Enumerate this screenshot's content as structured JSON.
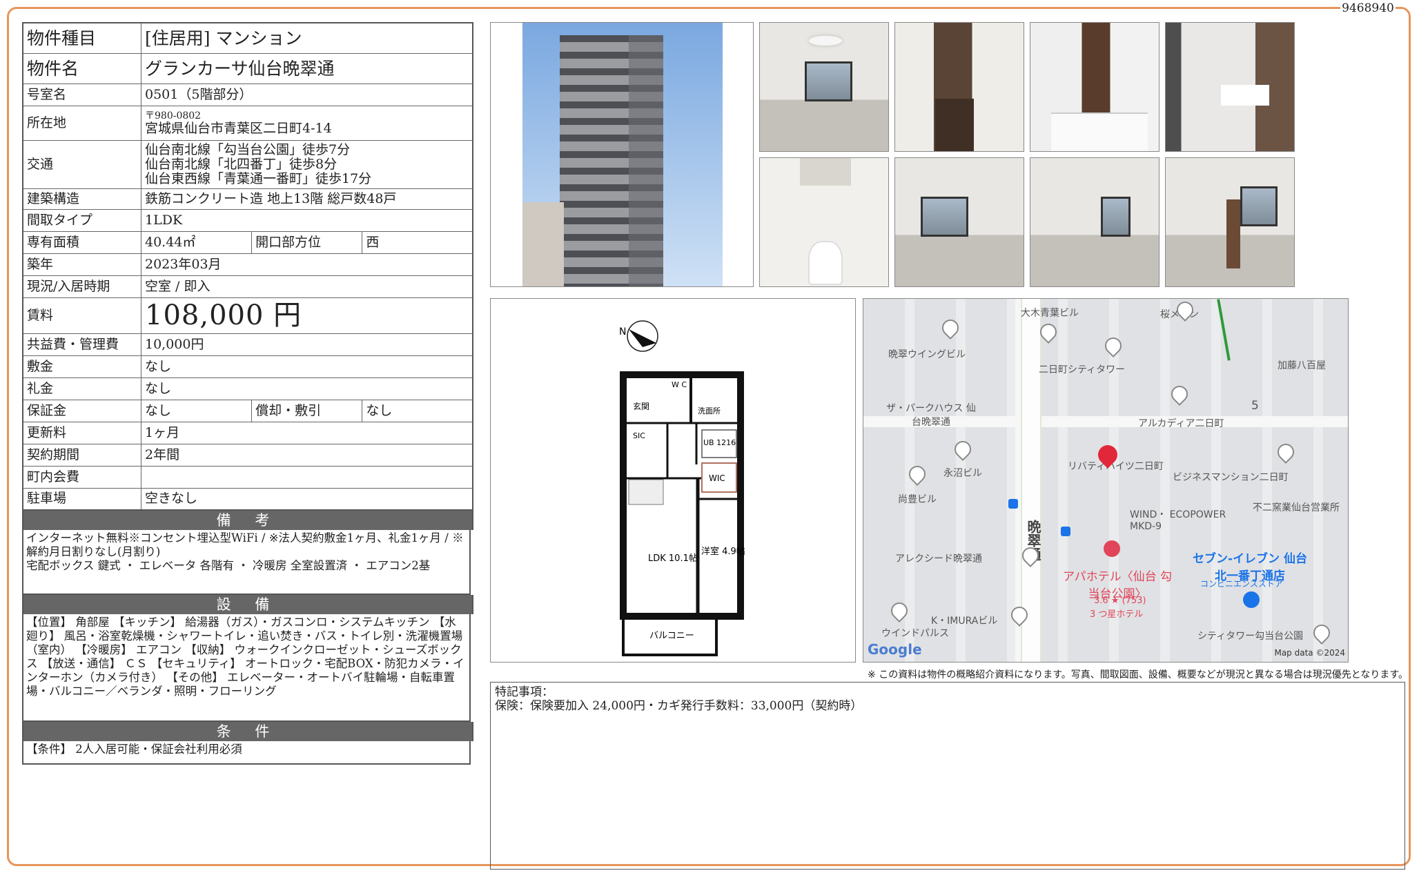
{
  "doc_number": "9468940",
  "props": {
    "type": {
      "label": "物件種目",
      "value": "[住居用] マンション"
    },
    "name": {
      "label": "物件名",
      "value": "グランカーサ仙台晩翠通"
    },
    "room": {
      "label": "号室名",
      "value": "0501（5階部分）"
    },
    "address": {
      "label": "所在地",
      "postal": "〒980-0802",
      "value": "宮城県仙台市青葉区二日町4-14"
    },
    "transit": {
      "label": "交通",
      "lines": [
        "仙台南北線「勾当台公園」徒歩7分",
        "仙台南北線「北四番丁」徒歩8分",
        "仙台東西線「青葉通一番町」徒歩17分"
      ]
    },
    "structure": {
      "label": "建築構造",
      "value": "鉄筋コンクリート造 地上13階 総戸数48戸"
    },
    "layout": {
      "label": "間取タイプ",
      "value": "1LDK"
    },
    "area": {
      "label": "専有面積",
      "value": "40.44㎡",
      "dir_label": "開口部方位",
      "dir_value": "西"
    },
    "built": {
      "label": "築年",
      "value": "2023年03月"
    },
    "status": {
      "label": "現況/入居時期",
      "value": "空室 / 即入"
    },
    "rent": {
      "label": "賃料",
      "value": "108,000 円"
    },
    "fee": {
      "label": "共益費・管理費",
      "value": "10,000円"
    },
    "deposit": {
      "label": "敷金",
      "value": "なし"
    },
    "key_money": {
      "label": "礼金",
      "value": "なし"
    },
    "guarantee": {
      "label": "保証金",
      "value": "なし",
      "sub_label": "償却・敷引",
      "sub_value": "なし"
    },
    "renewal": {
      "label": "更新料",
      "value": "1ヶ月"
    },
    "contract": {
      "label": "契約期間",
      "value": "2年間"
    },
    "town_fee": {
      "label": "町内会費",
      "value": ""
    },
    "parking": {
      "label": "駐車場",
      "value": "空きなし"
    }
  },
  "remarks": {
    "title": "備 考",
    "text": "インターネット無料※コンセント埋込型WiFi / ※法人契約敷金1ヶ月、礼金1ヶ月 / ※解約月日割りなし(月割り)\n宅配ボックス 鍵式 ・ エレベータ 各階有 ・ 冷暖房 全室設置済 ・ エアコン2基"
  },
  "facilities": {
    "title": "設 備",
    "text": "【位置】 角部屋 【キッチン】 給湯器（ガス）・ガスコンロ・システムキッチン 【水廻り】 風呂・浴室乾燥機・シャワートイレ・追い焚き・バス・トイレ別・洗濯機置場（室内） 【冷暖房】 エアコン 【収納】 ウォークインクローゼット・シューズボックス 【放送・通信】 ＣＳ 【セキュリティ】 オートロック・宅配BOX・防犯カメラ・インターホン（カメラ付き） 【その他】 エレベーター・オートバイ駐輪場・自転車置場・バルコニー／ベランダ・照明・フローリング"
  },
  "conditions": {
    "title": "条 件",
    "text": "【条件】 2人入居可能・保証会社利用必須"
  },
  "floorplan": {
    "rooms": {
      "entry": "玄関",
      "wc": "W C",
      "wash": "洗面所",
      "sic": "SIC",
      "ub": "UB 1216",
      "wic": "WIC",
      "ldk": "LDK 10.1帖",
      "western": "洋室 4.9帖",
      "balcony": "バルコニー"
    },
    "north": "N"
  },
  "map": {
    "road": "晩翠通",
    "block": "5",
    "pois": [
      "大木青葉ビル",
      "桜メゾン",
      "晩翠ウイングビル",
      "二日町シティタワー",
      "加藤八百屋",
      "ザ・パークハウス 仙台晩翠通",
      "アルカディア二日町",
      "リバティハイツ二日町",
      "ビジネスマンション二日町",
      "永沼ビル",
      "尚豊ビル",
      "不二窯業仙台営業所",
      "WIND・ ECOPOWER MKD-9",
      "アレクシード晩翠通",
      "セブン-イレブン 仙台北一番丁通店",
      "コンビニエンスストア",
      "アパホテル〈仙台 勾当台公園〉",
      "3.6 ★ (753)",
      "3 つ星ホテル",
      "K・IMURAビル",
      "ウインドパルス",
      "シティタワー勾当台公園"
    ],
    "google": "Google",
    "copyright": "Map data ©2024",
    "colors": {
      "pin": "#e0283a",
      "hotel": "#e0455a",
      "seven": "#1a73e8"
    }
  },
  "notice": "※ この資料は物件の概略紹介資料になります。写真、間取図面、設備、概要などが現況と異なる場合は現況優先となります。",
  "special": {
    "title": "特記事項：",
    "text": "保険：保険要加入 24,000円・カギ発行手数料：33,000円（契約時）"
  }
}
